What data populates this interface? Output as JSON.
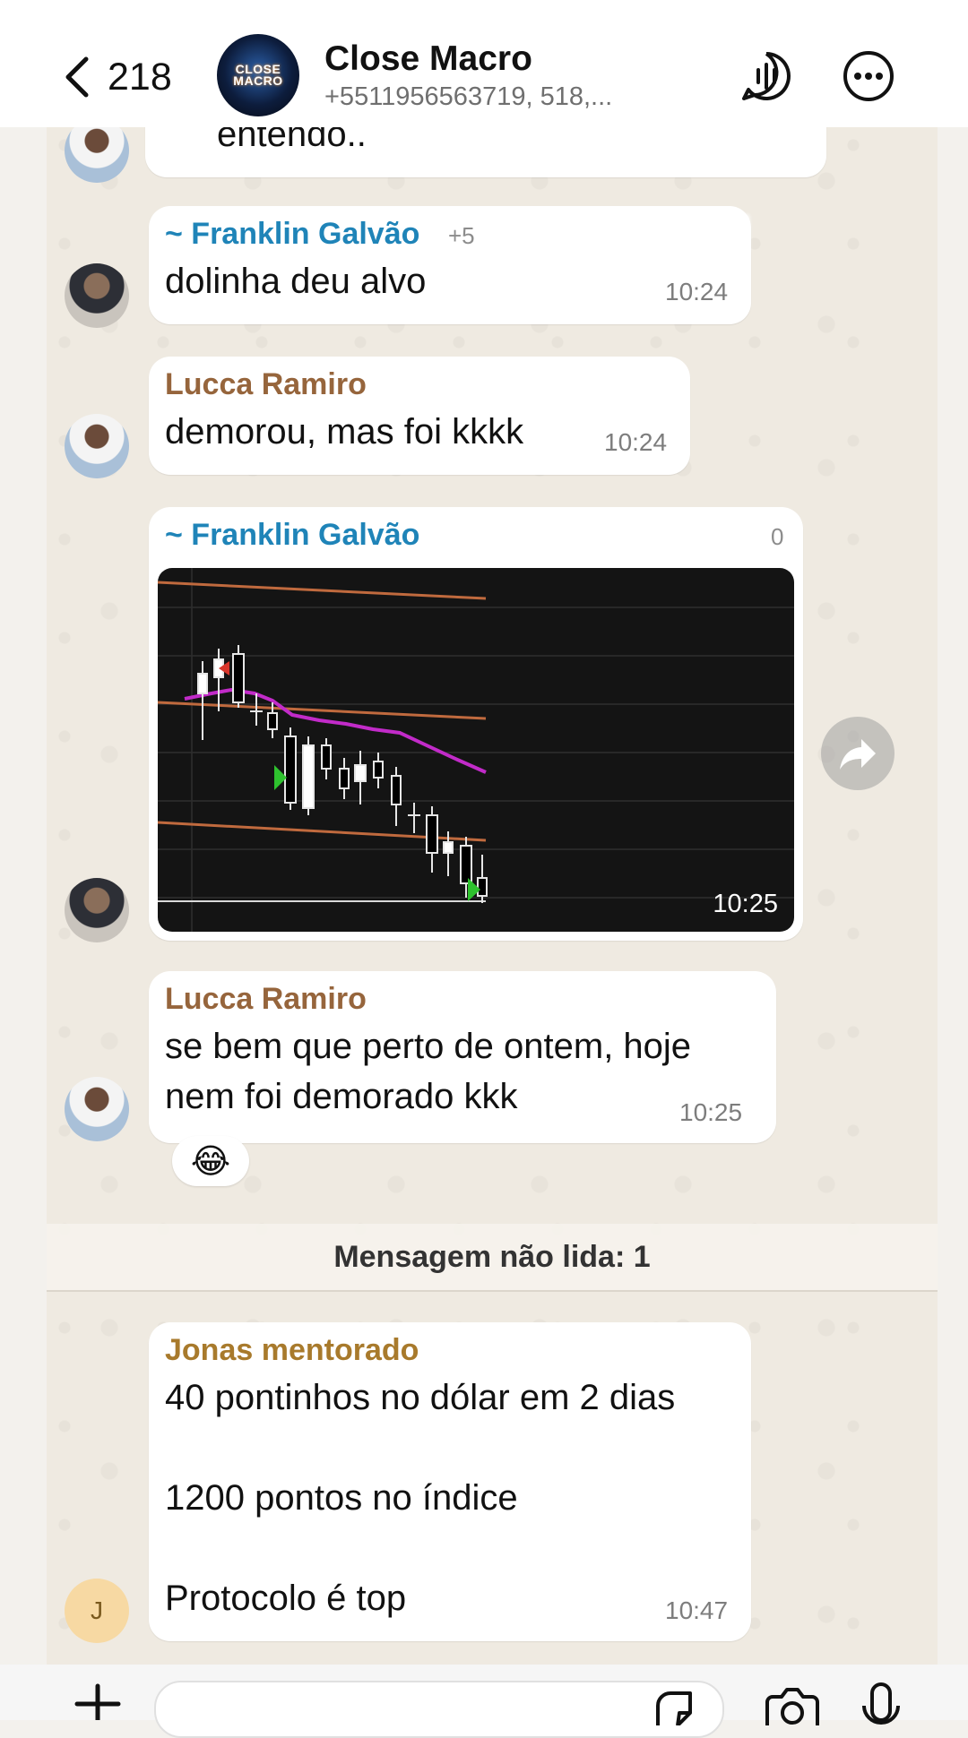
{
  "header": {
    "back_count": "218",
    "title": "Close Macro",
    "subtitle": "+5511956563719, 518,...",
    "avatar_text": "CLOSE MACRO"
  },
  "messages": [
    {
      "text": "entendo.."
    },
    {
      "sender": "~ Franklin Galvão",
      "sender_phone": "+5",
      "text": "dolinha deu alvo",
      "time": "10:24"
    },
    {
      "sender": "Lucca Ramiro",
      "text": "demorou, mas foi kkkk",
      "time": "10:24"
    },
    {
      "sender": "~ Franklin Galvão",
      "sender_phone": "0",
      "type": "image",
      "time": "10:25"
    },
    {
      "sender": "Lucca Ramiro",
      "lines": [
        "se bem que perto de ontem, hoje",
        "nem foi demorado kkk"
      ],
      "time": "10:25",
      "reaction": "😂"
    },
    {
      "sender": "Jonas mentorado",
      "avatar_initial": "J",
      "lines": [
        "40 pontinhos no dólar em 2 dias",
        "",
        "1200 pontos no índice",
        "",
        "Protocolo é top"
      ],
      "time": "10:47"
    }
  ],
  "unread_label": "Mensagem não lida: 1",
  "icons": {
    "back": "chevron-left-icon",
    "wave": "audio-wave-icon",
    "more": "more-horizontal-icon",
    "forward": "forward-arrow-icon",
    "plus": "plus-icon",
    "sticker": "sticker-icon",
    "camera": "camera-icon",
    "mic": "microphone-icon"
  },
  "colors": {
    "sender_blue": "#1f84b8",
    "sender_brown": "#96653c",
    "sender_gold": "#a87a2c",
    "chart_bg": "#141414",
    "moving_average": "#c22bc9",
    "level_lines": "#c06a3e"
  }
}
